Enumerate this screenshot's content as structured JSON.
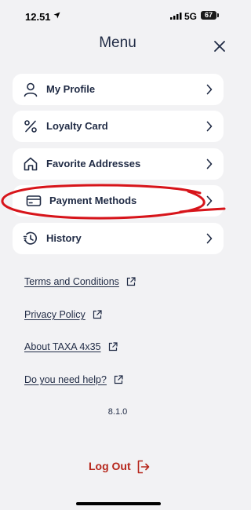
{
  "status_bar": {
    "time": "12.51",
    "network": "5G",
    "battery": "67"
  },
  "header": {
    "title": "Menu"
  },
  "menu_items": [
    {
      "label": "My Profile",
      "icon": "user-icon"
    },
    {
      "label": "Loyalty Card",
      "icon": "percent-icon"
    },
    {
      "label": "Favorite Addresses",
      "icon": "home-icon"
    },
    {
      "label": "Payment Methods",
      "icon": "credit-card-icon"
    },
    {
      "label": "History",
      "icon": "history-icon"
    }
  ],
  "links": [
    {
      "label": "Terms and Conditions"
    },
    {
      "label": "Privacy Policy"
    },
    {
      "label": "About TAXA 4x35"
    },
    {
      "label": "Do you need help?"
    }
  ],
  "version": "8.1.0",
  "logout": {
    "label": "Log Out"
  },
  "colors": {
    "background": "#f2f2f4",
    "card": "#ffffff",
    "text": "#1f2a44",
    "logout": "#b6261b",
    "annotation": "#d7141a"
  }
}
